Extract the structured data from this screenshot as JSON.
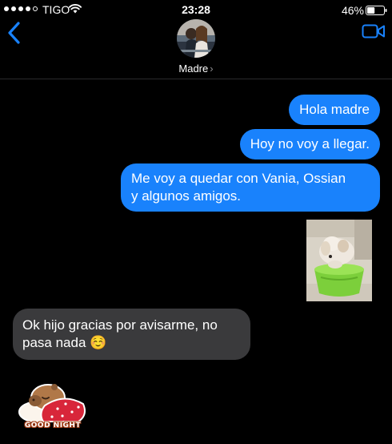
{
  "status_bar": {
    "carrier": "TIGO",
    "time": "23:28",
    "battery_percent": "46%",
    "battery_level": 0.46,
    "signal_bars": 4,
    "signal_max": 5
  },
  "header": {
    "contact_name": "Madre",
    "chevron": "›",
    "back_icon": "chevron-left-icon",
    "video_icon": "video-camera-icon"
  },
  "messages": [
    {
      "direction": "sent",
      "type": "text",
      "text": "Hola madre"
    },
    {
      "direction": "sent",
      "type": "text",
      "text": "Hoy no voy a llegar."
    },
    {
      "direction": "sent",
      "type": "text",
      "text": "Me voy a quedar con Vania, Ossian\ny algunos amigos."
    },
    {
      "direction": "sent",
      "type": "photo",
      "description_icon": "dog-in-green-bucket-photo"
    },
    {
      "direction": "received",
      "type": "text",
      "text": "Ok hijo gracias por avisarme, no\npasa nada ☺️"
    },
    {
      "direction": "received",
      "type": "sticker",
      "sticker_text": "GOOD NIGHT"
    }
  ],
  "colors": {
    "background": "#000000",
    "sent_bubble": "#1982fc",
    "received_bubble": "#3a3a3c",
    "accent": "#1982fc"
  }
}
